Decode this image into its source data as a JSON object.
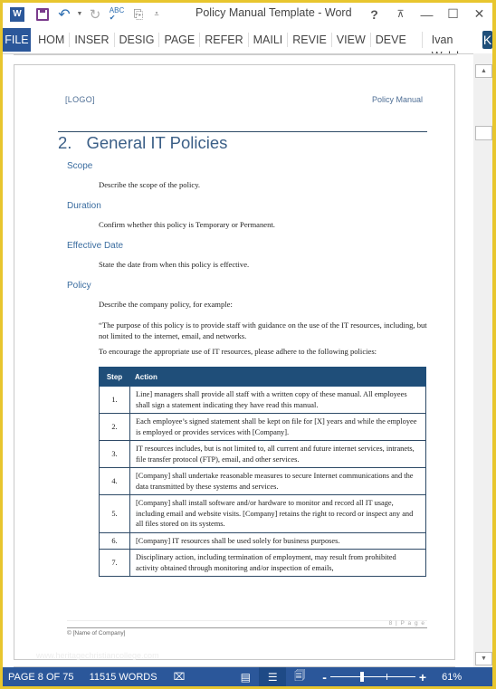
{
  "window": {
    "title": "Policy Manual Template - Word",
    "controls": {
      "help": "?",
      "ribbon_display": "⊼",
      "minimize": "—",
      "maximize": "☐",
      "close": "✕"
    }
  },
  "quick_access": {
    "app_icon": "W",
    "icons": [
      "word-icon",
      "save-icon",
      "undo-icon",
      "undo-dropdown-icon",
      "redo-icon",
      "spelling-icon",
      "touch-mode-icon",
      "customize-icon"
    ]
  },
  "ribbon": {
    "file_tab": "FILE",
    "tabs": [
      "HOM",
      "INSER",
      "DESIG",
      "PAGE",
      "REFER",
      "MAILI",
      "REVIE",
      "VIEW",
      "DEVE"
    ],
    "user_name": "Ivan Walsh",
    "avatar_letter": "K"
  },
  "document": {
    "header_left": "[LOGO]",
    "header_right": "Policy Manual",
    "heading_number": "2.",
    "heading_title": "General IT Policies",
    "sections": [
      {
        "title": "Scope",
        "body": "Describe the scope of the policy."
      },
      {
        "title": "Duration",
        "body": "Confirm whether this policy is Temporary or Permanent."
      },
      {
        "title": "Effective Date",
        "body": "State the date from when this policy is effective."
      },
      {
        "title": "Policy",
        "body": "Describe the company policy, for example:"
      }
    ],
    "quote": "“The purpose of this policy is to provide staff with guidance on the use of the IT resources, including, but not limited to the internet, email, and networks.",
    "intro": "To encourage the appropriate use of IT resources, please adhere to the following policies:",
    "table": {
      "headers": [
        "Step",
        "Action"
      ],
      "rows": [
        {
          "step": "1.",
          "action": "Line] managers shall provide all staff with a written copy of these manual. All employees shall sign a statement indicating they have read this manual."
        },
        {
          "step": "2.",
          "action": "Each employee’s signed statement shall be kept on file for [X] years and while the employee is employed or provides services with [Company]."
        },
        {
          "step": "3.",
          "action": "IT resources includes, but is not limited to, all current and future internet services, intranets, file transfer protocol (FTP), email, and other services."
        },
        {
          "step": "4.",
          "action": "[Company] shall undertake reasonable measures to secure Internet communications and the data transmitted by these systems and services."
        },
        {
          "step": "5.",
          "action": "[Company] shall install software and/or hardware to monitor and record all IT usage, including email and website visits. [Company] retains the right to record or inspect any and all files stored on its systems."
        },
        {
          "step": "6.",
          "action": "[Company] IT resources shall be used solely for business purposes."
        },
        {
          "step": "7.",
          "action": "Disciplinary action, including termination of employment, may result from prohibited activity obtained through monitoring and/or inspection of emails,"
        }
      ]
    },
    "footer_page": "8 | P a g e",
    "footer_copyright": "© [Name of Company]",
    "watermark": "www.heritagechristiancollege.com"
  },
  "status": {
    "page": "PAGE 8 OF 75",
    "words": "11515 WORDS",
    "zoom_percent": "61%",
    "zoom_value": 61,
    "views": [
      "read-mode",
      "print-layout",
      "web-layout"
    ],
    "active_view": "print-layout"
  },
  "colors": {
    "accent": "#2b579a",
    "heading": "#3b5f87",
    "table_header": "#1f4e79",
    "frame": "#e8c62e"
  }
}
